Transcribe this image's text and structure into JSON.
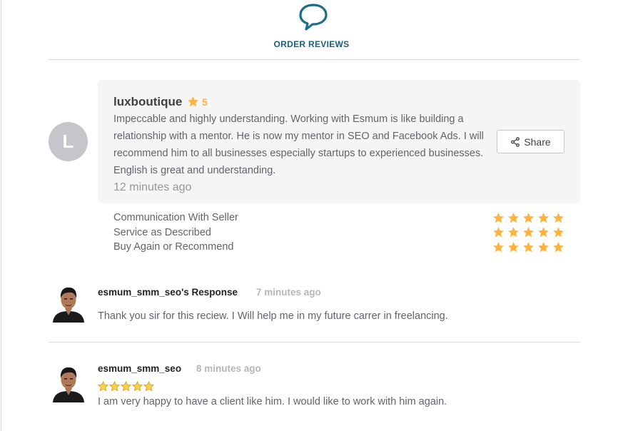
{
  "header": {
    "icon": "speech-bubble-icon",
    "title": "ORDER REVIEWS"
  },
  "colors": {
    "accent": "#1a5e7a",
    "star": "#ffb33e",
    "box_bg": "#f5f5f5"
  },
  "review": {
    "avatar_letter": "L",
    "reviewer": "luxboutique",
    "rating": "5",
    "text": "Impeccable and highly understanding. Working with Esmum is like building a relationship with a mentor. He is now my mentor in SEO and Facebook Ads. I will recommend him to all businesses especially startups to experienced businesses. English is great and understanding.",
    "time": "12 minutes ago",
    "share_label": "Share",
    "criteria": [
      {
        "label": "Communication With Seller",
        "stars": 5
      },
      {
        "label": "Service as Described",
        "stars": 5
      },
      {
        "label": "Buy Again or Recommend",
        "stars": 5
      }
    ]
  },
  "seller_response": {
    "name": "esmum_smm_seo's Response",
    "time": "7 minutes ago",
    "text": "Thank you sir for this reciew. I Will help me in my future carrer in freelancing."
  },
  "seller_review": {
    "name": "esmum_smm_seo",
    "time": "8 minutes ago",
    "stars": 5,
    "text": "I am very happy to have a client like him. I would like to work with him again."
  }
}
